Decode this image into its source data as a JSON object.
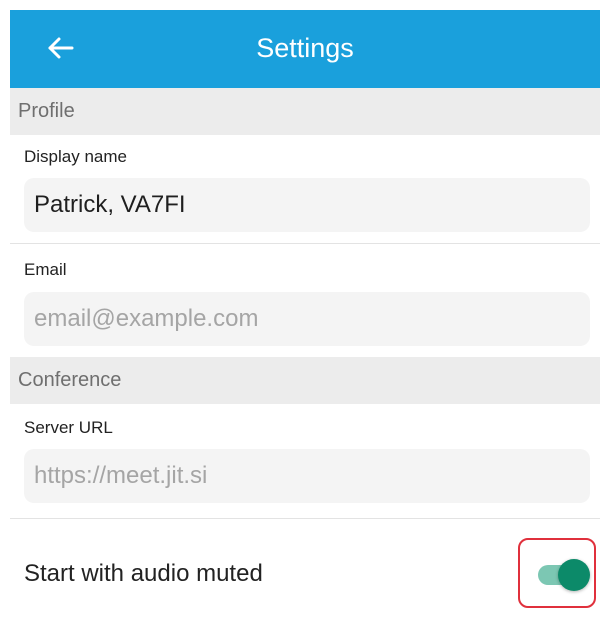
{
  "appbar": {
    "title": "Settings",
    "back_icon": "arrow-left-icon",
    "background_color": "#1aa0dc"
  },
  "profile": {
    "section_title": "Profile",
    "display_name": {
      "label": "Display name",
      "value": "Patrick, VA7FI"
    },
    "email": {
      "label": "Email",
      "placeholder": "email@example.com"
    }
  },
  "conference": {
    "section_title": "Conference",
    "server_url": {
      "label": "Server URL",
      "placeholder": "https://meet.jit.si"
    },
    "start_audio_muted": {
      "label": "Start with audio muted",
      "enabled": true,
      "toggle_color": "#0c8a69",
      "highlight_color": "#e0303c"
    }
  }
}
